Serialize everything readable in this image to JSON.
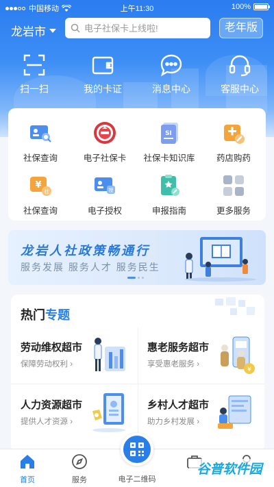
{
  "status": {
    "carrier": "中国移动",
    "time": "上午11:30",
    "battery": "100%"
  },
  "topbar": {
    "city": "龙岩市",
    "search_placeholder": "电子社保卡上线啦!",
    "elder_mode": "老年版"
  },
  "quick_actions": [
    {
      "label": "扫一扫",
      "icon": "scan-icon"
    },
    {
      "label": "我的卡证",
      "icon": "wallet-icon"
    },
    {
      "label": "消息中心",
      "icon": "message-icon"
    },
    {
      "label": "客服中心",
      "icon": "headset-icon"
    }
  ],
  "services": [
    {
      "label": "社保查询",
      "icon": "id-card-search-icon"
    },
    {
      "label": "电子社保卡",
      "icon": "social-security-badge-icon"
    },
    {
      "label": "社保卡知识库",
      "icon": "si-document-icon"
    },
    {
      "label": "药店购药",
      "icon": "pharmacy-icon"
    },
    {
      "label": "社保查询",
      "icon": "yuan-coin-icon"
    },
    {
      "label": "电子授权",
      "icon": "authorization-card-icon"
    },
    {
      "label": "申报指南",
      "icon": "guide-clipboard-icon"
    },
    {
      "label": "更多服务",
      "icon": "more-services-icon"
    }
  ],
  "banner": {
    "title": "龙岩人社政策畅通行",
    "subtitle": "服务发展 服务人才 服务民生",
    "pages": 3,
    "active_page": 1
  },
  "hot_topics": {
    "title_part1": "热门",
    "title_part2": "专题",
    "items": [
      {
        "title": "劳动维权超市",
        "subtitle": "保障劳动权利 ›"
      },
      {
        "title": "惠老服务超市",
        "subtitle": "享受惠老服务 ›"
      },
      {
        "title": "人力资源超市",
        "subtitle": "提供人才资源 ›"
      },
      {
        "title": "乡村人才超市",
        "subtitle": "助力乡村发展 ›"
      }
    ]
  },
  "tabbar": {
    "home": "首页",
    "service": "服务",
    "qr": "电子二维码"
  },
  "watermark": "谷普软件园",
  "colors": {
    "primary": "#2a7ee8",
    "header_top": "#2b7df0"
  }
}
